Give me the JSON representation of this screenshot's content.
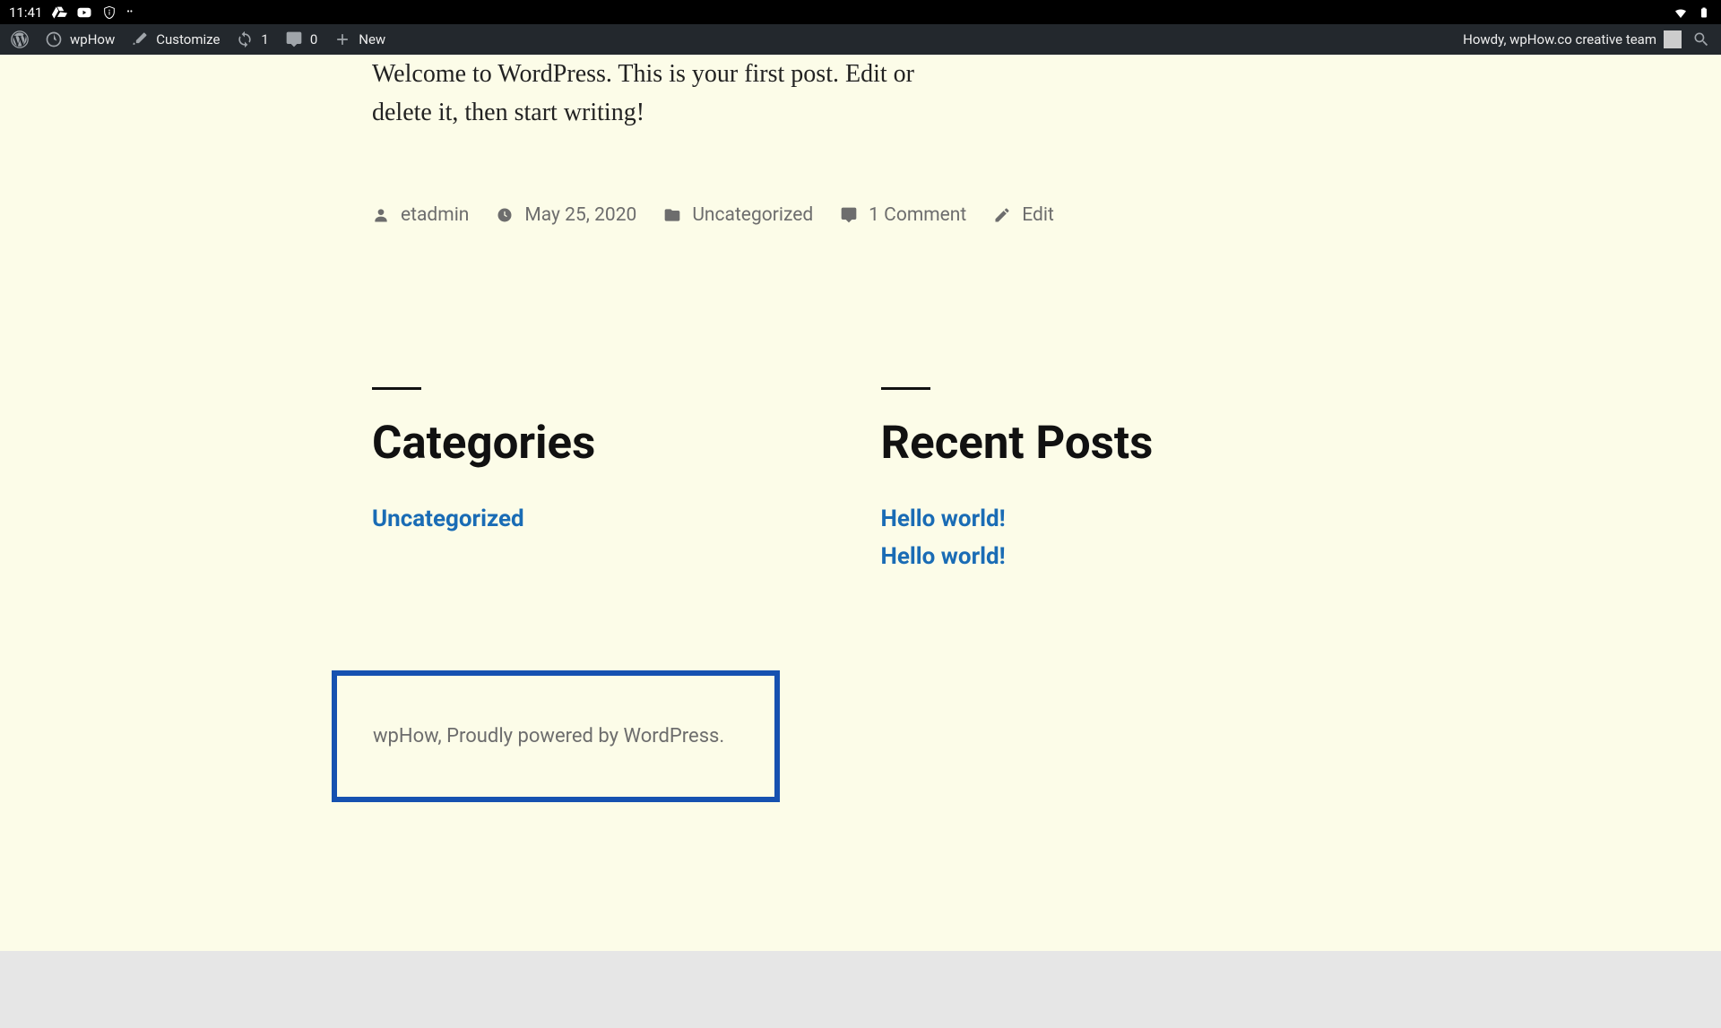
{
  "statusBar": {
    "time": "11:41"
  },
  "wpAdminBar": {
    "siteName": "wpHow",
    "customize": "Customize",
    "updateCount": "1",
    "commentCount": "0",
    "newLabel": "New",
    "howdy": "Howdy, wpHow.co creative team"
  },
  "post": {
    "content": "Welcome to WordPress. This is your first post. Edit or delete it, then start writing!",
    "author": "etadmin",
    "date": "May 25, 2020",
    "category": "Uncategorized",
    "commentText": "1 Comment",
    "editLabel": "Edit"
  },
  "widgets": {
    "categories": {
      "title": "Categories",
      "items": [
        "Uncategorized"
      ]
    },
    "recentPosts": {
      "title": "Recent Posts",
      "items": [
        "Hello world!",
        "Hello world!"
      ]
    }
  },
  "footer": {
    "credit": "wpHow, Proudly powered by WordPress."
  }
}
